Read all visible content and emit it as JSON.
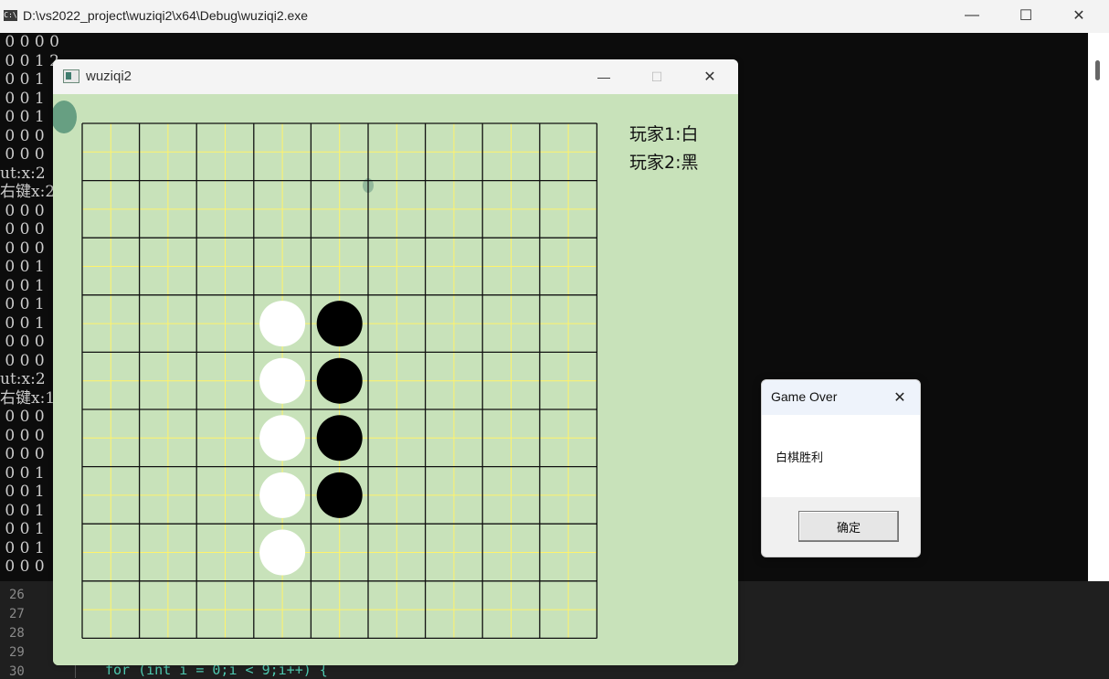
{
  "console": {
    "title": "D:\\vs2022_project\\wuziqi2\\x64\\Debug\\wuziqi2.exe",
    "icon": "console-app-icon",
    "icon_text": "C:\\",
    "minimize_glyph": "—",
    "maximize_glyph": "☐",
    "close_glyph": "✕",
    "lines": [
      " 0 0 0 0 0 0 0 0 0",
      " 0 0 1 2 0 0 0 0",
      " 0 0 1",
      " 0 0 1",
      " 0 0 1",
      " 0 0 0",
      " 0 0 0",
      "ut:x:2",
      "右键x:2",
      " 0 0 0",
      " 0 0 0",
      " 0 0 0",
      " 0 0 1",
      " 0 0 1",
      " 0 0 1",
      " 0 0 1",
      " 0 0 0",
      " 0 0 0",
      "ut:x:2",
      "右键x:1",
      " 0 0 0",
      " 0 0 0",
      " 0 0 0",
      " 0 0 1",
      " 0 0 1",
      " 0 0 1",
      " 0 0 1",
      " 0 0 1",
      " 0 0 0"
    ]
  },
  "editor": {
    "line_numbers": [
      "26",
      "27",
      "28",
      "29",
      "30"
    ],
    "code_line_30": "for (int i = 0;i < 9;i++) {"
  },
  "game": {
    "title": "wuziqi2",
    "icon": "app-window-icon",
    "minimize_glyph": "—",
    "maximize_glyph": "☐",
    "close_glyph": "✕",
    "player1": "玩家1:白",
    "player2": "玩家2:黑",
    "board": {
      "cols": 9,
      "rows": 9,
      "white_stones": [
        [
          3,
          3
        ],
        [
          3,
          4
        ],
        [
          3,
          5
        ],
        [
          3,
          6
        ],
        [
          3,
          7
        ]
      ],
      "black_stones": [
        [
          4,
          3
        ],
        [
          4,
          4
        ],
        [
          4,
          5
        ],
        [
          4,
          6
        ]
      ]
    },
    "colors": {
      "background": "#c8e2ba",
      "grid": "#111111",
      "guide": "#fff36a",
      "white": "#ffffff",
      "black": "#000000"
    }
  },
  "dialog": {
    "title": "Game Over",
    "message": "白棋胜利",
    "ok_label": "确定",
    "close_glyph": "✕"
  }
}
